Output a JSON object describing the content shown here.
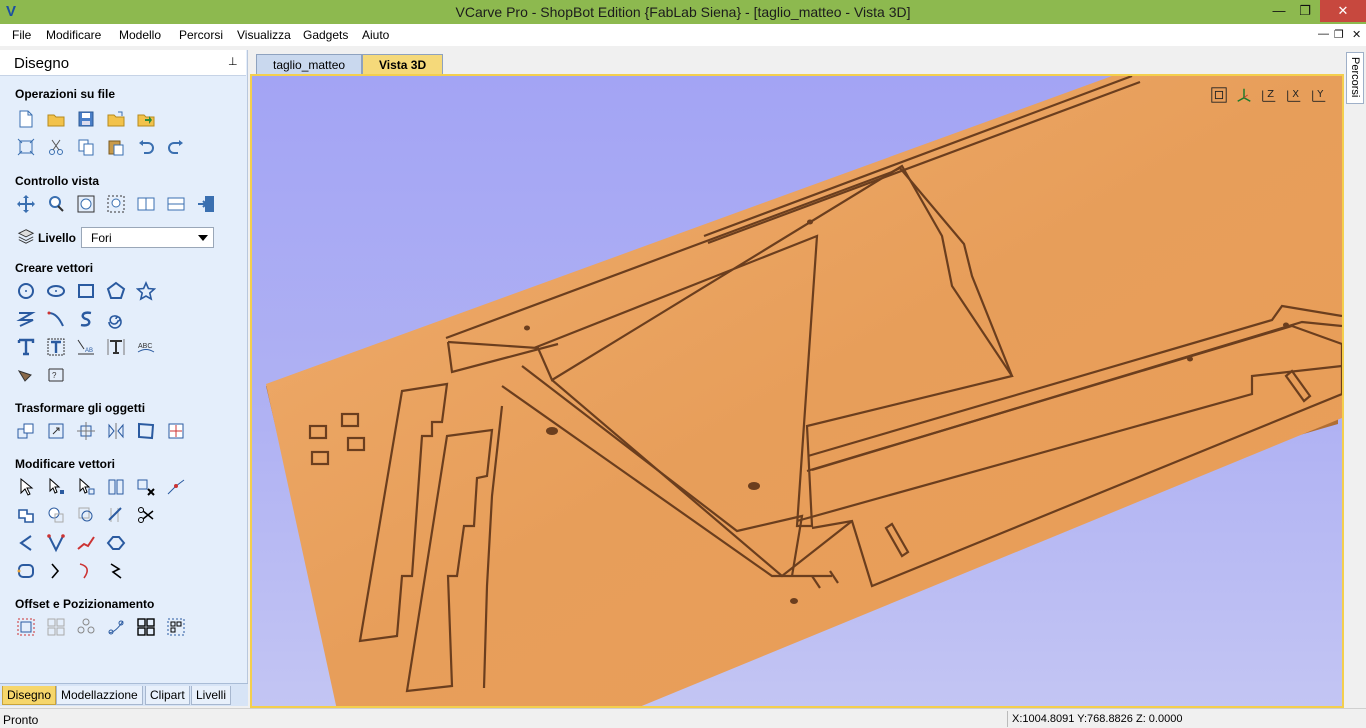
{
  "window": {
    "title": "VCarve Pro - ShopBot Edition {FabLab Siena} - [taglio_matteo - Vista 3D]",
    "logo": "V",
    "controls": {
      "minimize": "—",
      "maximize": "❐",
      "close": "✕"
    }
  },
  "menu": {
    "items": [
      "File",
      "Modificare",
      "Modello",
      "Percorsi",
      "Visualizza",
      "Gadgets",
      "Aiuto"
    ],
    "mdi": {
      "minimize": "—",
      "restore": "❐",
      "close": "✕"
    }
  },
  "left_panel": {
    "title": "Disegno",
    "pin": "⊥",
    "sections": {
      "file_ops": "Operazioni su file",
      "view_control": "Controllo vista",
      "create_vectors": "Creare vettori",
      "transform": "Trasformare gli oggetti",
      "edit_vectors": "Modificare vettori",
      "offset": "Offset e Pozizionamento"
    },
    "layer": {
      "label": "Livello",
      "value": "Fori"
    },
    "bottom_tabs": [
      "Disegno",
      "Modellazzione",
      "Clipart",
      "Livelli"
    ],
    "active_bottom_tab": "Disegno"
  },
  "doc_tabs": {
    "tabs": [
      "taglio_matteo",
      "Vista 3D"
    ],
    "active": "Vista 3D"
  },
  "viewport": {
    "background_top": "#a3a4f4",
    "board_color": "#e8a060",
    "cut_color": "#6b3e1e",
    "view_icons": [
      "zoom-extents-icon",
      "iso-view-icon",
      "top-view-z-icon",
      "front-view-x-icon",
      "side-view-y-icon"
    ],
    "axis_labels": [
      "Z",
      "X",
      "Y"
    ]
  },
  "right_tab": {
    "label": "Percorsi"
  },
  "status": {
    "left": "Pronto",
    "coords": "X:1004.8091 Y:768.8826 Z:  0.0000"
  }
}
